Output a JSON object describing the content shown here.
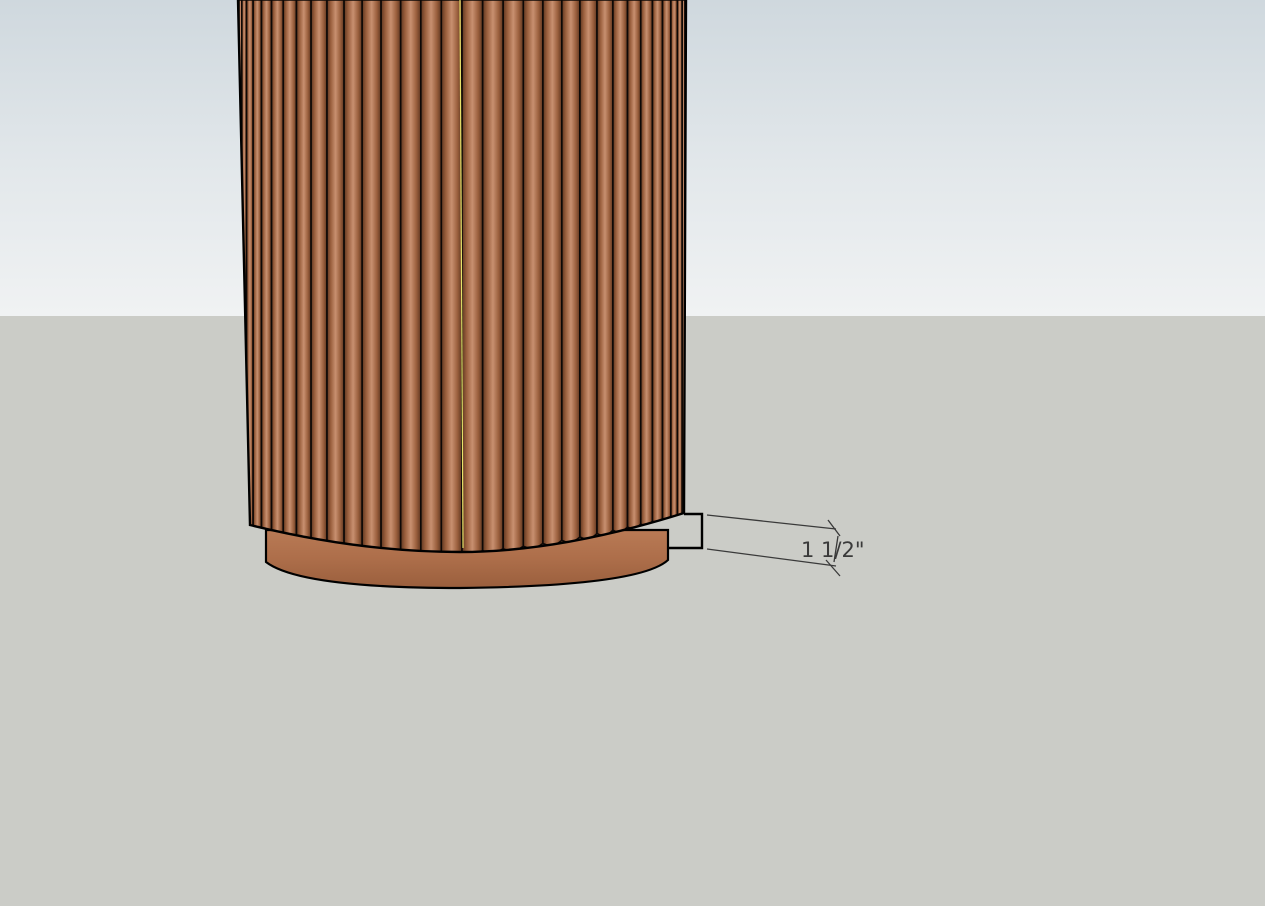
{
  "viewport": {
    "sky_color_top": "#cfd8de",
    "sky_color_bottom": "#f0f2f3",
    "ground_color": "#cbccc7",
    "wood_color_light": "#c0845e",
    "wood_color_dark": "#6b3f26",
    "edge_color": "#000000",
    "selection_seam_color": "#e8e36a"
  },
  "model": {
    "name": "fluted-column",
    "flute_count": 34
  },
  "dimension": {
    "label": "1 1/2\""
  }
}
